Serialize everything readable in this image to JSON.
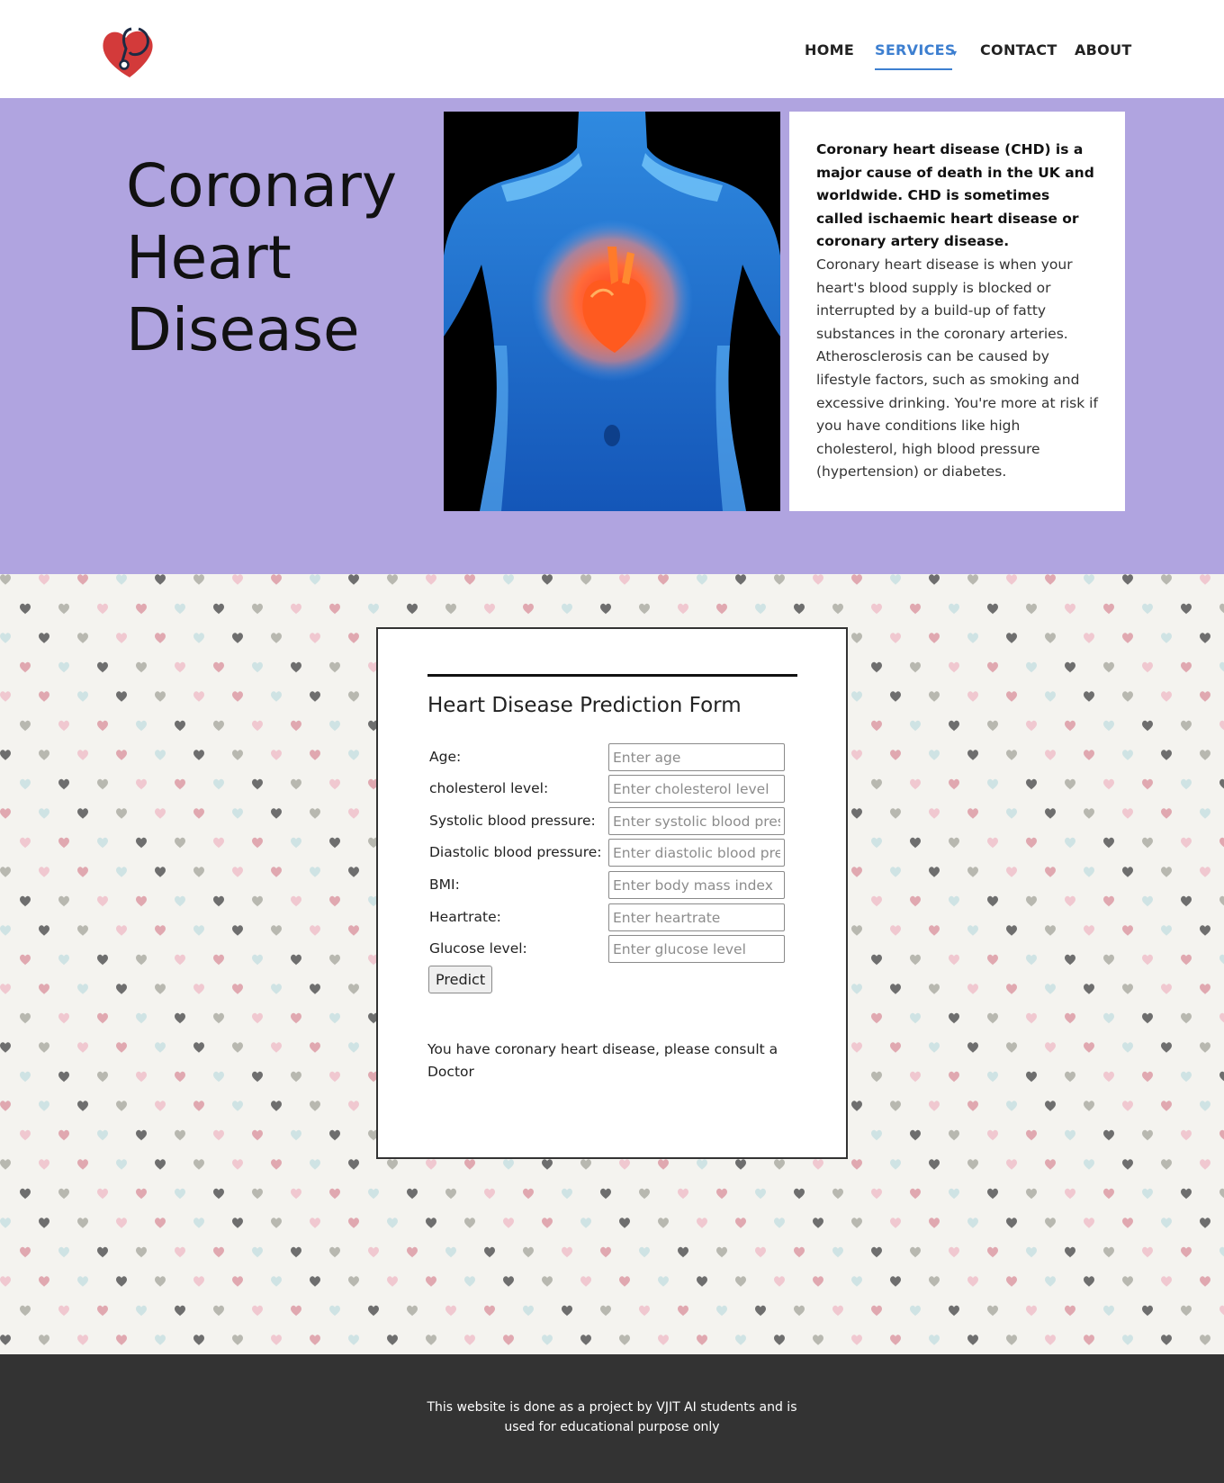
{
  "header": {
    "logo_icon": "heart-stethoscope-icon",
    "nav": {
      "home": "HOME",
      "services": "SERVICES",
      "contact": "CONTACT",
      "about": "ABOUT"
    },
    "active_item": "SERVICES",
    "accent_color": "#3d7fd0"
  },
  "hero": {
    "background_color": "#b0a4e0",
    "title_lines": [
      "Coronary",
      "Heart",
      "Disease"
    ],
    "image_icon": "human-torso-heart-icon",
    "card": {
      "lead": "Coronary heart disease (CHD) is a major cause of death in the UK and worldwide. CHD is sometimes called ischaemic heart disease or coronary artery disease.",
      "body": "Coronary heart disease is when your heart's blood supply is blocked or interrupted by a build-up of fatty substances in the coronary arteries. Atherosclerosis can be caused by lifestyle factors, such as smoking and excessive drinking. You're more at risk if you have conditions like high cholesterol, high blood pressure (hypertension) or diabetes."
    }
  },
  "form": {
    "title": "Heart Disease Prediction Form",
    "fields": [
      {
        "label": "Age:",
        "placeholder": "Enter age",
        "value": ""
      },
      {
        "label": "cholesterol level:",
        "placeholder": "Enter cholesterol level",
        "value": ""
      },
      {
        "label": "Systolic blood pressure:",
        "placeholder": "Enter systolic blood pressure",
        "value": ""
      },
      {
        "label": "Diastolic blood pressure:",
        "placeholder": "Enter diastolic blood pressure",
        "value": ""
      },
      {
        "label": "BMI:",
        "placeholder": "Enter body mass index",
        "value": ""
      },
      {
        "label": "Heartrate:",
        "placeholder": "Enter heartrate",
        "value": ""
      },
      {
        "label": "Glucose level:",
        "placeholder": "Enter glucose level",
        "value": ""
      }
    ],
    "submit_label": "Predict",
    "result": "You have coronary heart disease, please consult a Doctor"
  },
  "pattern": {
    "icon": "heart-icon",
    "colors": [
      "#6e6e6e",
      "#e0a8b0",
      "#b8b8b0",
      "#cfe3e4",
      "#f0c8d0"
    ]
  },
  "footer": {
    "text": "This website is done as a project by VJIT AI students and is used for educational purpose only",
    "background_color": "#333333"
  }
}
